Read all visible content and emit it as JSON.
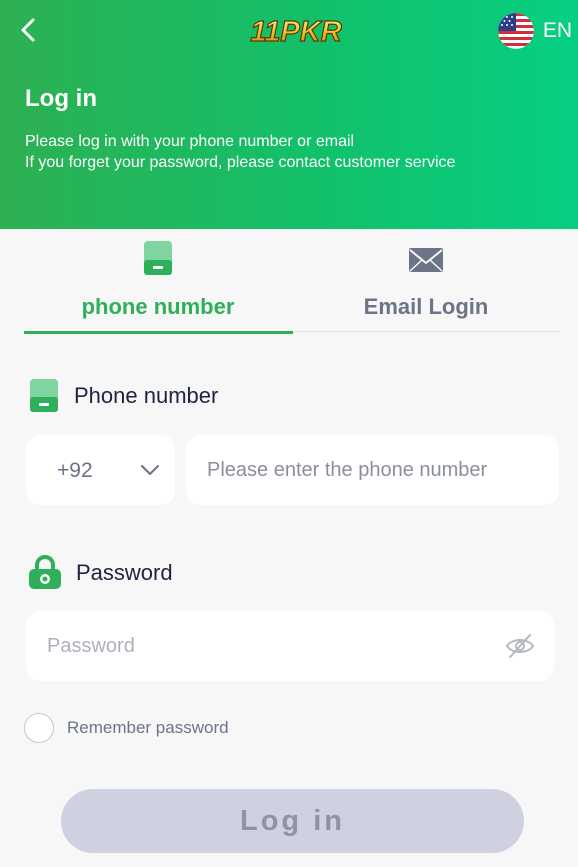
{
  "header": {
    "logo_text": "11PKR",
    "language": "EN",
    "title": "Log in",
    "subtitle_line1": "Please log in with your phone number or email",
    "subtitle_line2": "If you forget your password, please contact customer service"
  },
  "tabs": [
    {
      "label": "phone number",
      "icon": "phone-icon",
      "active": true
    },
    {
      "label": "Email Login",
      "icon": "mail-icon",
      "active": false
    }
  ],
  "phone": {
    "label": "Phone number",
    "country_code": "+92",
    "placeholder": "Please enter the phone number"
  },
  "password": {
    "label": "Password",
    "placeholder": "Password"
  },
  "remember": {
    "label": "Remember password",
    "checked": false
  },
  "login_button": "Log in",
  "colors": {
    "accent": "#2eb05a",
    "header_gradient_start": "#2db052",
    "header_gradient_end": "#06cf82",
    "button_disabled": "#cfd1e0"
  }
}
